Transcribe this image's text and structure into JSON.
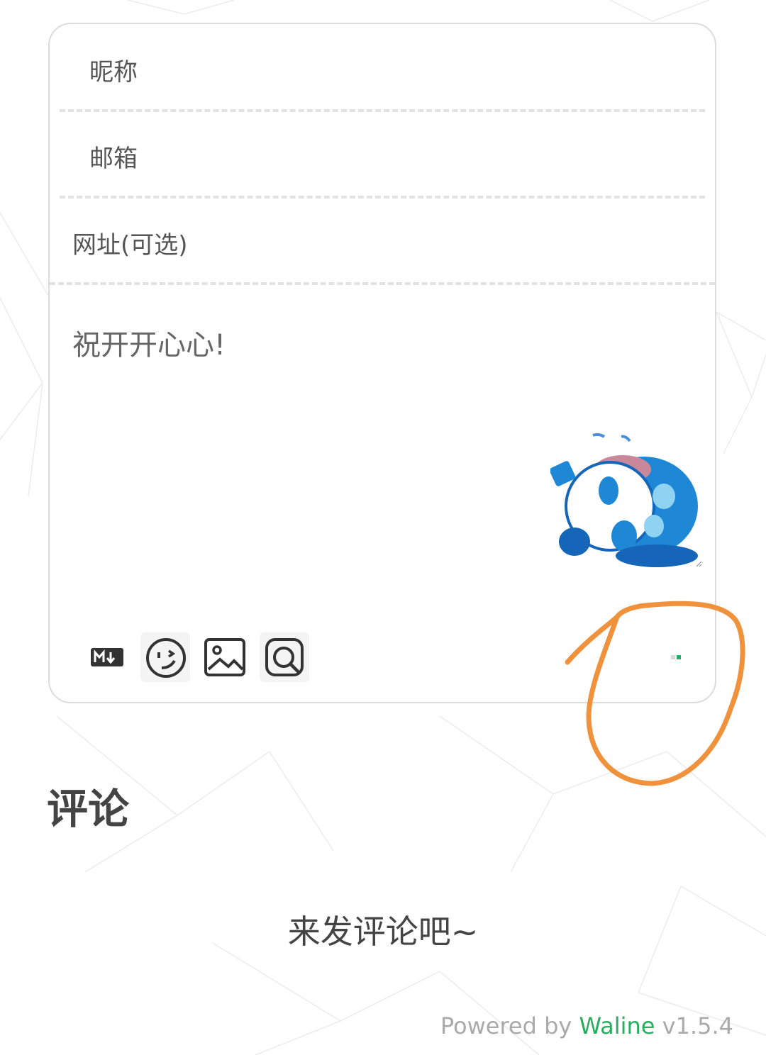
{
  "form": {
    "nick_placeholder": "昵称",
    "mail_placeholder": "邮箱",
    "link_placeholder": "网址(可选)",
    "comment_text": "祝开开心心!"
  },
  "toolbar": {
    "icons": [
      "markdown-icon",
      "emoji-icon",
      "image-icon",
      "preview-icon"
    ]
  },
  "comments": {
    "title": "评论",
    "empty_text": "来发评论吧~"
  },
  "footer": {
    "powered_by": "Powered by",
    "brand": "Waline",
    "version": "v1.5.4"
  },
  "colors": {
    "accent": "#27ae60",
    "annotation": "#f0913c"
  }
}
